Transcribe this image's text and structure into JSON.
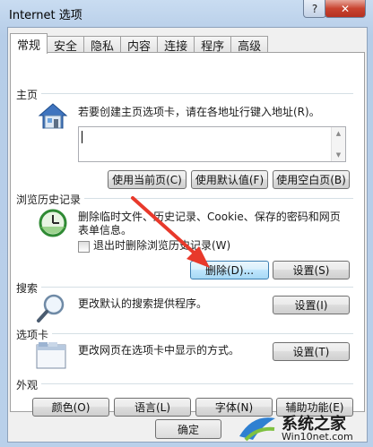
{
  "window": {
    "title": "Internet 选项",
    "help": "?",
    "close": "✕"
  },
  "tabs": [
    "常规",
    "安全",
    "隐私",
    "内容",
    "连接",
    "程序",
    "高级"
  ],
  "homepage": {
    "section": "主页",
    "description": "若要创建主页选项卡，请在各地址行键入地址(R)。",
    "url_value": "",
    "btn_current": "使用当前页(C)",
    "btn_default": "使用默认值(F)",
    "btn_blank": "使用空白页(B)"
  },
  "history": {
    "section": "浏览历史记录",
    "description": "删除临时文件、历史记录、Cookie、保存的密码和网页表单信息。",
    "checkbox_label": "退出时删除浏览历史记录(W)",
    "checkbox_checked": false,
    "btn_delete": "删除(D)...",
    "btn_settings": "设置(S)"
  },
  "search": {
    "section": "搜索",
    "description": "更改默认的搜索提供程序。",
    "btn_settings": "设置(I)"
  },
  "tabs_section": {
    "section": "选项卡",
    "description": "更改网页在选项卡中显示的方式。",
    "btn_settings": "设置(T)"
  },
  "appearance": {
    "section": "外观",
    "btn_colors": "颜色(O)",
    "btn_languages": "语言(L)",
    "btn_fonts": "字体(N)",
    "btn_accessibility": "辅助功能(E)"
  },
  "footer": {
    "ok": "确定"
  },
  "watermark": {
    "title": "系统之家",
    "sub": "Win10net.com"
  },
  "colors": {
    "annotation_arrow": "#e8392b",
    "title_bar": "#bcd3ec"
  }
}
